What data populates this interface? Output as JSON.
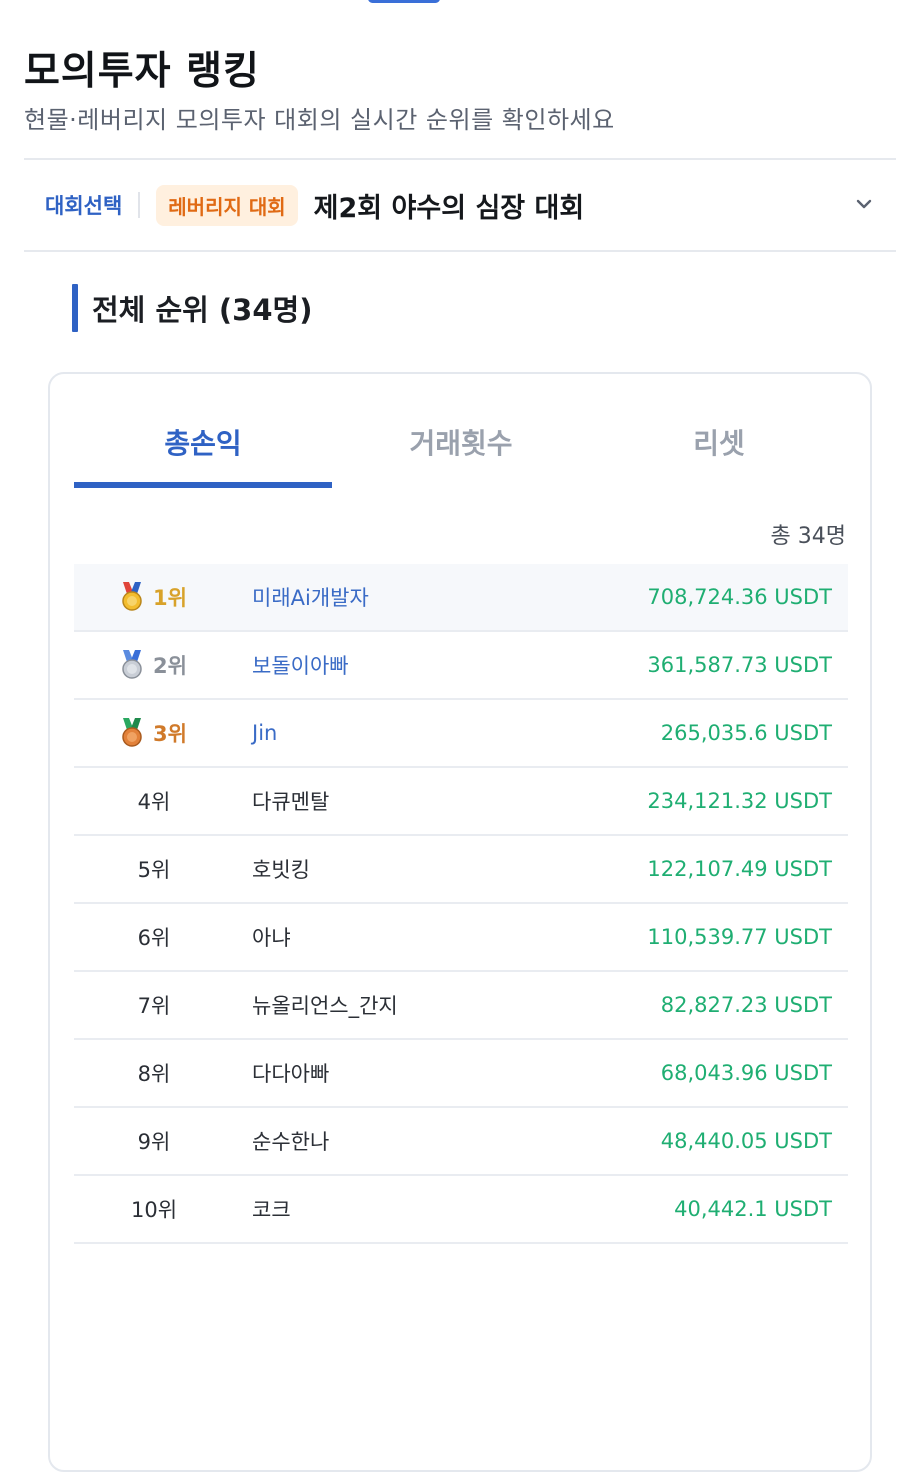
{
  "header": {
    "title": "모의투자 랭킹",
    "subtitle": "현물·레버리지 모의투자 대회의 실시간 순위를 확인하세요"
  },
  "contest": {
    "label": "대회선택",
    "badge": "레버리지 대회",
    "name": "제2회 야수의 심장 대회"
  },
  "section": {
    "title": "전체 순위 (34명)"
  },
  "tabs": [
    {
      "label": "총손익",
      "active": true
    },
    {
      "label": "거래횟수",
      "active": false
    },
    {
      "label": "리셋",
      "active": false
    }
  ],
  "total_label": "총 34명",
  "rankings": [
    {
      "rank": "1위",
      "name": "미래Ai개발자",
      "value": "708,724.36 USDT",
      "medal": "gold"
    },
    {
      "rank": "2위",
      "name": "보돌이아빠",
      "value": "361,587.73 USDT",
      "medal": "silver"
    },
    {
      "rank": "3위",
      "name": "Jin",
      "value": "265,035.6 USDT",
      "medal": "bronze"
    },
    {
      "rank": "4위",
      "name": "다큐멘탈",
      "value": "234,121.32 USDT"
    },
    {
      "rank": "5위",
      "name": "호빗킹",
      "value": "122,107.49 USDT"
    },
    {
      "rank": "6위",
      "name": "아냐",
      "value": "110,539.77 USDT"
    },
    {
      "rank": "7위",
      "name": "뉴올리언스_간지",
      "value": "82,827.23 USDT"
    },
    {
      "rank": "8위",
      "name": "다다아빠",
      "value": "68,043.96 USDT"
    },
    {
      "rank": "9위",
      "name": "순수한나",
      "value": "48,440.05 USDT"
    },
    {
      "rank": "10위",
      "name": "코크",
      "value": "40,442.1 USDT"
    }
  ],
  "colors": {
    "accent": "#2f62c4",
    "profit": "#1fae72",
    "badge_bg": "#fff0df",
    "badge_text": "#e06a14",
    "gold": "#d8a22a",
    "silver": "#8a9099",
    "bronze": "#d07a2a"
  }
}
